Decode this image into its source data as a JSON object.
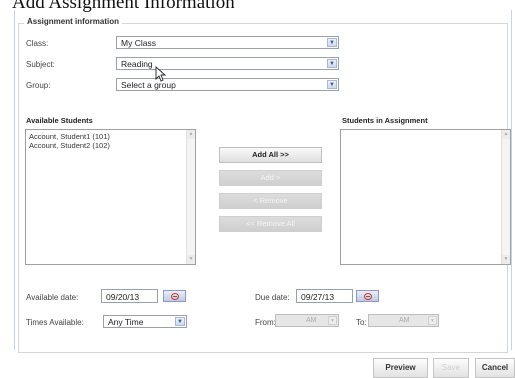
{
  "page": {
    "title": "Add Assignment Information"
  },
  "assignment": {
    "legend": "Assignment information",
    "class_label": "Class:",
    "class_value": "My Class",
    "subject_label": "Subject:",
    "subject_value": "Reading",
    "group_label": "Group:",
    "group_value": "Select a group"
  },
  "students": {
    "available_heading": "Available Students",
    "in_assignment_heading": "Students in Assignment",
    "available": [
      "Account, Student1 (101)",
      "Account, Student2 (102)"
    ],
    "in_assignment": []
  },
  "transfer_buttons": {
    "add_all": "Add All >>",
    "add": "Add >",
    "remove": "< Remove",
    "remove_all": "<< Remove All"
  },
  "schedule": {
    "available_date_label": "Available date:",
    "available_date_value": "09/20/13",
    "due_date_label": "Due date:",
    "due_date_value": "09/27/13",
    "times_available_label": "Times Available:",
    "times_available_value": "Any Time",
    "from_label": "From:",
    "from_ampm": "AM",
    "to_label": "To:",
    "to_ampm": "AM"
  },
  "footer": {
    "preview": "Preview",
    "save": "Save",
    "cancel": "Cancel"
  },
  "icons": {
    "dropdown": "chevron-down-icon",
    "calendar": "calendar-icon",
    "pointer": "mouse-pointer-icon"
  },
  "colors": {
    "accent_border": "#c8d2e4",
    "dropdown_arrow": "#3a5a9a",
    "calendar_icon": "#c0392b"
  }
}
